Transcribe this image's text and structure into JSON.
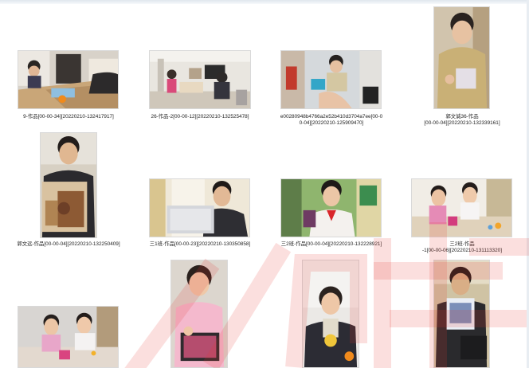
{
  "items": [
    {
      "caption": [
        "9-作品[00-00-34][20220210-132417917]"
      ]
    },
    {
      "caption": [
        "26-作品-2[00-00-12][20220210-132525478]"
      ]
    },
    {
      "caption": [
        "e00280948b4766a2e52b410d3704a7ee[00-0",
        "0-04][20220210-125909470]"
      ]
    },
    {
      "caption": [
        "郭文诚36-作品",
        "[00-00-04][20220210-132339161]"
      ]
    },
    {
      "caption": [
        "郭文远-作品[00-00-04][20220210-132250409]"
      ]
    },
    {
      "caption": [
        "三1班-作品[00-00-23][20220210-130350858]"
      ]
    },
    {
      "caption": [
        "三2班-作品[00-00-04][20220210-132228921]"
      ]
    },
    {
      "caption": [
        "三2班-作品",
        "-1[00-00-06][20220210-131113320]"
      ]
    },
    {
      "caption": []
    },
    {
      "caption": []
    },
    {
      "caption": []
    },
    {
      "caption": []
    }
  ],
  "colors": {
    "watermark": "#e8352f",
    "caption_text": "#222222",
    "background": "#ffffff"
  }
}
